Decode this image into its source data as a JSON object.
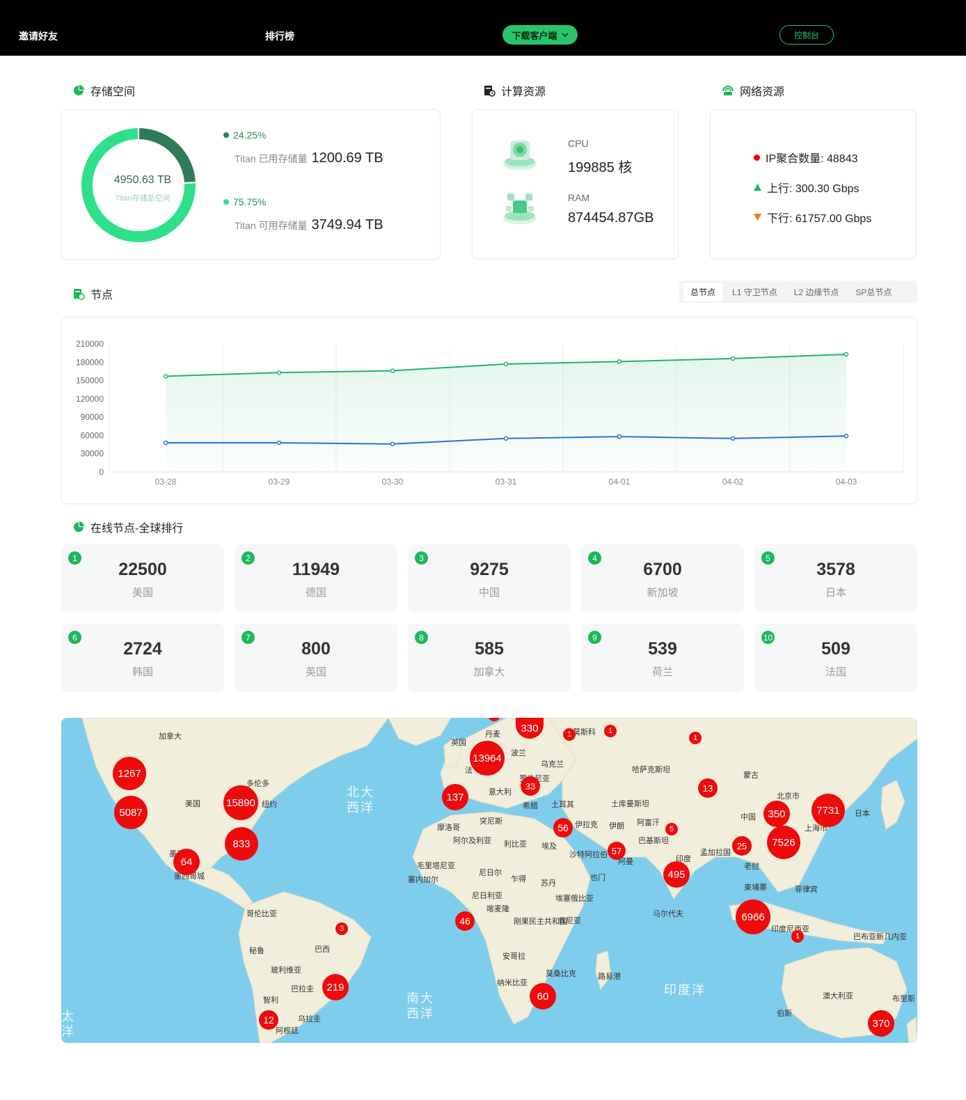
{
  "nav": {
    "invite": "邀请好友",
    "ranking": "排行榜",
    "download": "下载客户端",
    "console": "控制台"
  },
  "colors": {
    "accent": "#29c56b",
    "used": "#2f7a58",
    "available": "#2fe08b",
    "bubble": "#ee0b0b",
    "line_total": "#1fb46a",
    "line_l1": "#2f6fd8"
  },
  "storage": {
    "title": "存储空间",
    "icon": "pie-chart-icon",
    "total": "4950.63 TB",
    "total_label": "Titan存储总空间",
    "used_pct": "24.25%",
    "used_label": "Titan 已用存储量",
    "used_value": "1200.69 TB",
    "avail_pct": "75.75%",
    "avail_label": "Titan 可用存储量",
    "avail_value": "3749.94 TB",
    "used_fraction": 0.2425
  },
  "compute": {
    "title": "计算资源",
    "icon": "server-icon",
    "cpu_label": "CPU",
    "cpu_value": "199885 核",
    "ram_label": "RAM",
    "ram_value": "874454.87GB"
  },
  "network": {
    "title": "网络资源",
    "icon": "network-icon",
    "ip": "IP聚合数量: 48843",
    "up": "上行: 300.30 Gbps",
    "down": "下行: 61757.00 Gbps"
  },
  "nodes": {
    "title": "节点",
    "icon": "node-icon",
    "tabs": [
      "总节点",
      "L1 守卫节点",
      "L2 边缘节点",
      "SP总节点"
    ],
    "active_tab": 0
  },
  "chart_data": {
    "type": "line",
    "x": [
      "03-28",
      "03-29",
      "03-30",
      "03-31",
      "04-01",
      "04-02",
      "04-03"
    ],
    "yticks": [
      "210000",
      "180000",
      "150000",
      "120000",
      "90000",
      "60000",
      "30000",
      "0"
    ],
    "ylim": [
      0,
      210000
    ],
    "series": [
      {
        "values": [
          157000,
          163000,
          166000,
          177000,
          181000,
          186000,
          193000
        ]
      },
      {
        "values": [
          48000,
          48000,
          46000,
          55000,
          58000,
          55000,
          59000
        ]
      }
    ]
  },
  "ranking": {
    "title": "在线节点-全球排行",
    "items": [
      {
        "rank": "1",
        "value": "22500",
        "country": "美国"
      },
      {
        "rank": "2",
        "value": "11949",
        "country": "德国"
      },
      {
        "rank": "3",
        "value": "9275",
        "country": "中国"
      },
      {
        "rank": "4",
        "value": "6700",
        "country": "新加坡"
      },
      {
        "rank": "5",
        "value": "3578",
        "country": "日本"
      },
      {
        "rank": "6",
        "value": "2724",
        "country": "韩国"
      },
      {
        "rank": "7",
        "value": "800",
        "country": "英国"
      },
      {
        "rank": "8",
        "value": "585",
        "country": "加拿大"
      },
      {
        "rank": "9",
        "value": "539",
        "country": "荷兰"
      },
      {
        "rank": "10",
        "value": "509",
        "country": "法国"
      }
    ]
  },
  "map": {
    "oceans": [
      "北大\n西洋",
      "南大\n西洋",
      "印度洋",
      "太\n洋"
    ],
    "labels": [
      "加拿大",
      "美国",
      "多伦多",
      "纽约",
      "墨西哥",
      "墨西哥城",
      "哥伦比亚",
      "秘鲁",
      "巴西",
      "玻利维亚",
      "巴拉圭",
      "智利",
      "乌拉圭",
      "阿根廷",
      "英国",
      "丹麦",
      "波兰",
      "乌克兰",
      "莫斯科",
      "哈萨克斯坦",
      "蒙古",
      "北京市",
      "中国",
      "日本",
      "上海市",
      "意大利",
      "罗马尼亚",
      "希腊",
      "土耳其",
      "土库曼斯坦",
      "突尼斯",
      "摩洛哥",
      "阿尔及利亚",
      "利比亚",
      "埃及",
      "伊拉克",
      "伊朗",
      "阿富汗",
      "巴基斯坦",
      "印度",
      "孟加拉国",
      "老挝",
      "柬埔寨",
      "菲律宾",
      "沙特阿拉伯",
      "阿曼",
      "也门",
      "毛里塔尼亚",
      "塞内加尔",
      "尼日尔",
      "乍得",
      "苏丹",
      "尼日利亚",
      "喀麦隆",
      "埃塞俄比亚",
      "刚果民主共和国",
      "肯尼亚",
      "安哥拉",
      "纳米比亚",
      "莫桑比克",
      "路易港",
      "马尔代夫",
      "印度尼西亚",
      "巴布亚新几内亚",
      "澳大利亚",
      "布里斯",
      "伯斯",
      "法"
    ],
    "bubbles": [
      "1267",
      "5087",
      "15890",
      "833",
      "64",
      "137",
      "13964",
      "330",
      "33",
      "56",
      "57",
      "495",
      "13",
      "350",
      "7731",
      "7526",
      "25",
      "6966",
      "46",
      "60",
      "219",
      "12",
      "370",
      "3",
      "1",
      "1",
      "1",
      "1",
      "1",
      "5"
    ]
  }
}
